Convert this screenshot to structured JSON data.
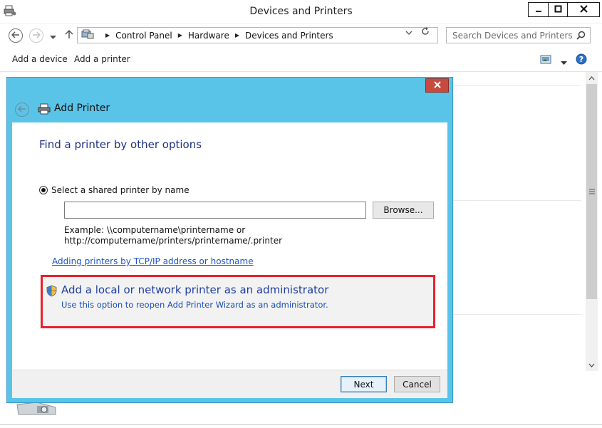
{
  "window": {
    "title": "Devices and Printers"
  },
  "address_bar": {
    "crumbs": [
      "Control Panel",
      "Hardware",
      "Devices and Printers"
    ],
    "search_placeholder": "Search Devices and Printers"
  },
  "command_bar": {
    "add_device": "Add a device",
    "add_printer": "Add a printer"
  },
  "dialog": {
    "title": "Add Printer",
    "heading": "Find a printer by other options",
    "radio_label": "Select a shared printer by name",
    "printer_name_value": "",
    "browse_label": "Browse...",
    "example_line1": "Example: \\\\computername\\printername or",
    "example_line2": "http://computername/printers/printername/.printer",
    "tcp_link": "Adding printers by TCP/IP address or hostname",
    "admin_title": "Add a local or network printer as an administrator",
    "admin_subtitle": "Use this option to reopen Add Printer Wizard as an administrator.",
    "next_label": "Next",
    "cancel_label": "Cancel"
  },
  "colors": {
    "dialog_frame": "#5ac4e8",
    "highlight_border": "#e8212e",
    "link": "#1a55c4",
    "heading": "#1e3287",
    "close_button": "#c74a3e"
  },
  "icons": {
    "window_app": "devices-printers-icon",
    "dialog_printer": "printer-icon",
    "admin": "uac-shield-icon"
  }
}
